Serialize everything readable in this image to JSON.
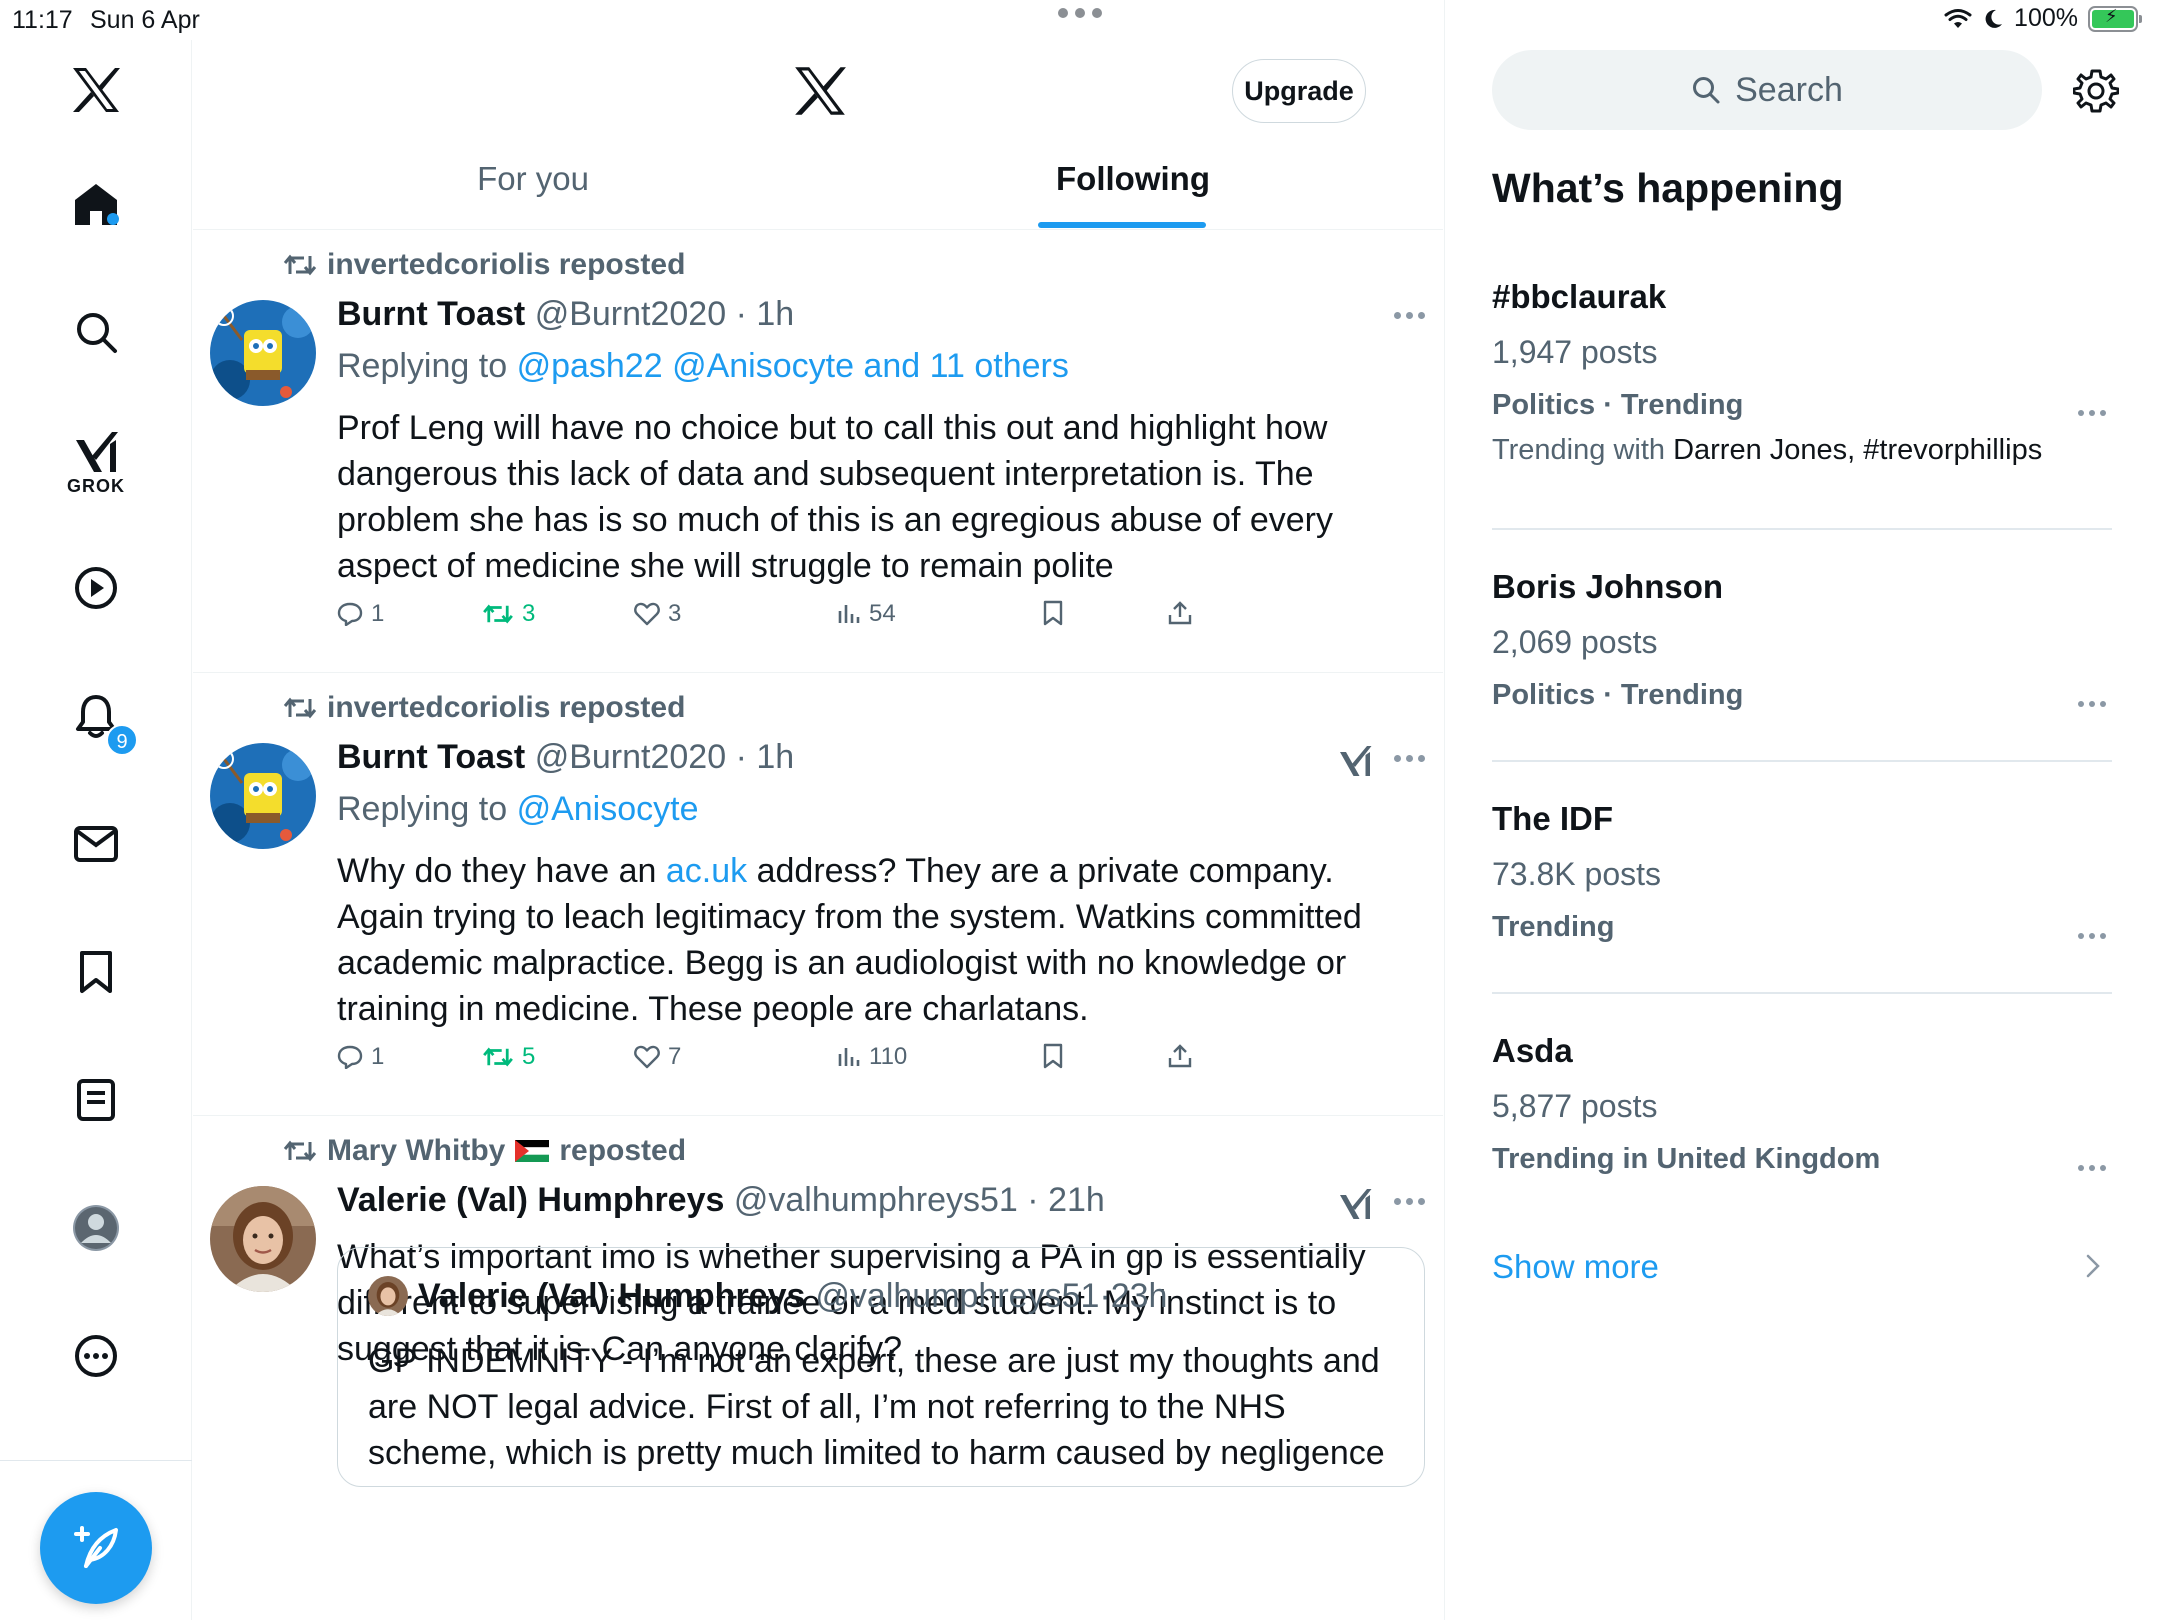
{
  "status_bar": {
    "time": "11:17",
    "date": "Sun 6 Apr",
    "battery": "100%"
  },
  "left_nav": {
    "grok_label": "GROK",
    "notifications_badge": "9",
    "icons": [
      "x-logo-icon",
      "home-icon",
      "search-icon",
      "grok-icon",
      "video-icon",
      "bell-icon",
      "mail-icon",
      "bookmark-icon",
      "list-icon",
      "profile-icon",
      "more-icon",
      "compose-icon"
    ]
  },
  "header": {
    "upgrade_label": "Upgrade",
    "tabs": [
      {
        "label": "For you",
        "active": false
      },
      {
        "label": "Following",
        "active": true
      }
    ]
  },
  "tweets": [
    {
      "repost_by": "invertedcoriolis reposted",
      "name": "Burnt Toast",
      "handle": "@Burnt2020",
      "time": "1h",
      "reply_prefix": "Replying to",
      "reply_to": "@pash22 @Anisocyte and 11 others",
      "text": "Prof Leng will have no choice but to call this out and highlight how dangerous this lack of data and subsequent interpretation is. The problem she has is so much of this is an egregious abuse of every aspect of medicine she will struggle to remain polite",
      "replies": "1",
      "reposts": "3",
      "likes": "3",
      "views": "54"
    },
    {
      "repost_by": "invertedcoriolis reposted",
      "name": "Burnt Toast",
      "handle": "@Burnt2020",
      "time": "1h",
      "reply_prefix": "Replying to",
      "reply_to": "@Anisocyte",
      "text_before": "Why do they have an ",
      "text_link": "ac.uk",
      "text_after": " address? They are a private company. Again trying to leach legitimacy from the system. Watkins committed academic malpractice. Begg is an audiologist with no knowledge or training in medicine. These people are charlatans.",
      "replies": "1",
      "reposts": "5",
      "likes": "7",
      "views": "110"
    },
    {
      "repost_by": "Mary Whitby",
      "repost_suffix": "reposted",
      "name": "Valerie (Val) Humphreys",
      "handle": "@valhumphreys51",
      "time": "21h",
      "text": "What’s important imo is whether supervising a PA in gp is essentially different to supervising a trainee or a med student. My instinct is to suggest that it is. Can anyone clarify?",
      "quote": {
        "name": "Valerie (Val) Humphreys",
        "handle": "@valhumphreys51",
        "time": "23h",
        "text": "GP INDEMNITY - I’m not an expert, these are just my thoughts and are NOT legal advice. First of all, I’m not referring to the NHS scheme, which is pretty much limited to harm caused by negligence"
      }
    }
  ],
  "sidebar": {
    "search_placeholder": "Search",
    "section_title": "What’s happening",
    "trends": [
      {
        "name": "#bbclaurak",
        "count": "1,947 posts",
        "category": "Politics · Trending",
        "with_prefix": "Trending with",
        "with_names": "Darren Jones, #trevorphillips"
      },
      {
        "name": "Boris Johnson",
        "count": "2,069 posts",
        "category": "Politics · Trending"
      },
      {
        "name": "The IDF",
        "count": "73.8K posts",
        "category": "Trending"
      },
      {
        "name": "Asda",
        "count": "5,877 posts",
        "category": "Trending in United Kingdom"
      }
    ],
    "show_more": "Show more"
  },
  "colors": {
    "accent": "#1d9bf0",
    "repost_green": "#00ba7c",
    "secondary_text": "#536471",
    "primary_text": "#0f1419"
  }
}
